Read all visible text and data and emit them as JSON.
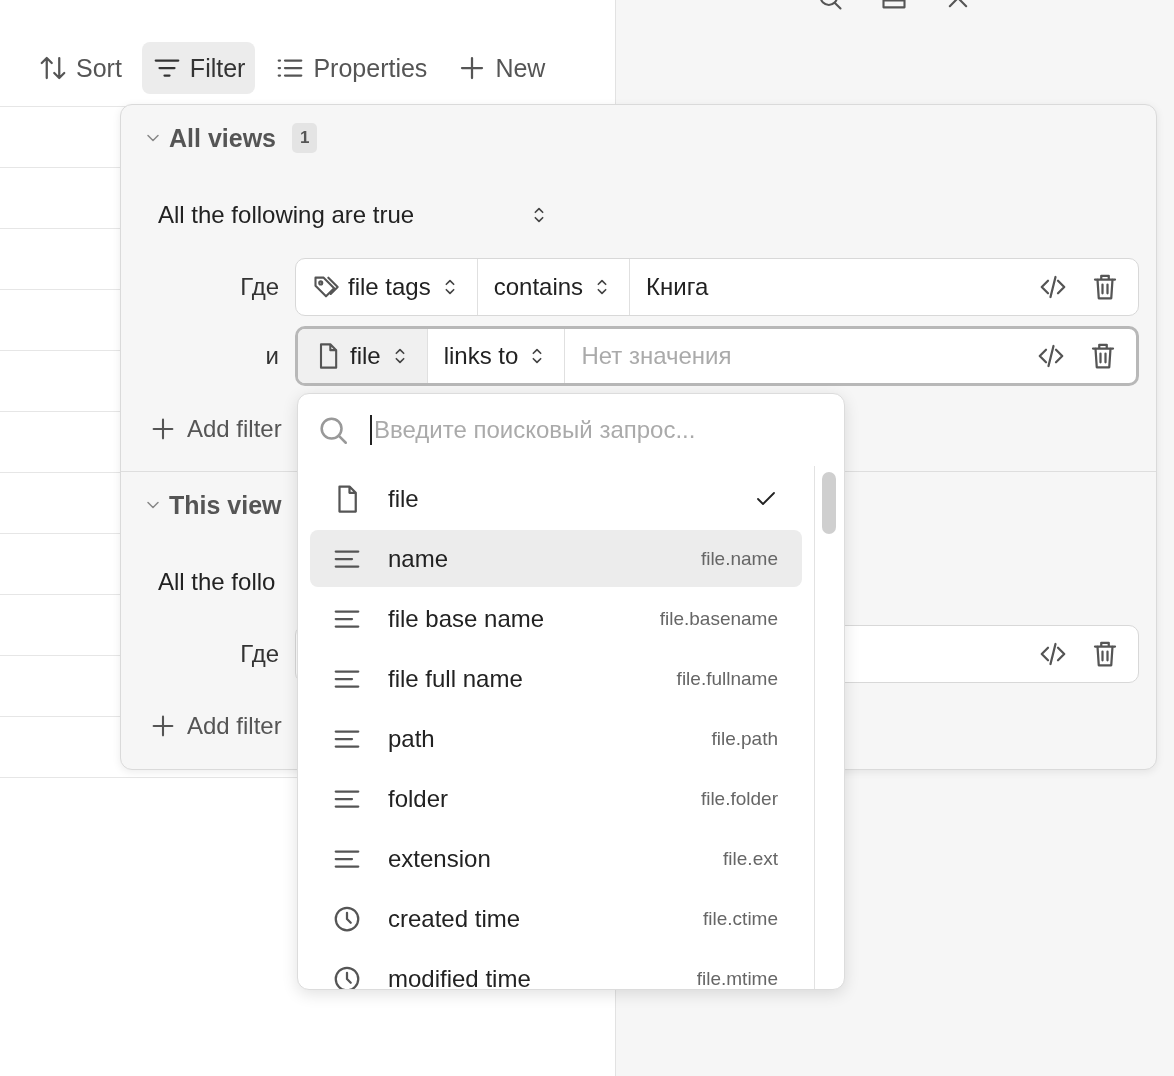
{
  "toolbar": [
    {
      "label": "Sort",
      "kind": "sort",
      "selected": false
    },
    {
      "label": "Filter",
      "kind": "filter",
      "selected": true
    },
    {
      "label": "Properties",
      "kind": "list",
      "selected": false
    },
    {
      "label": "New",
      "kind": "plus",
      "selected": false
    }
  ],
  "filter_panel": {
    "sections": [
      {
        "title": "All views",
        "count": "1",
        "expanded": true,
        "conjunction": "All the following are true",
        "filters": [
          {
            "prefix": "Где",
            "property": {
              "label": "file tags",
              "kind": "tag"
            },
            "operator": "contains",
            "value": "Книга",
            "active": false
          },
          {
            "prefix": "и",
            "property": {
              "label": "file",
              "kind": "file"
            },
            "operator": "links to",
            "placeholder": "Нет значения",
            "active": true
          }
        ],
        "add_label": "Add filter"
      },
      {
        "title": "This view",
        "expanded": true,
        "conjunction": "All the follo",
        "filters": [
          {
            "prefix": "Где",
            "active": false
          }
        ],
        "add_label": "Add filter"
      }
    ]
  },
  "property_dropdown": {
    "search": {
      "placeholder": "Введите поисковый запрос..."
    },
    "items": [
      {
        "label": "file",
        "kind": "file",
        "checked": true,
        "selected": false
      },
      {
        "label": "name",
        "key": "file.name",
        "kind": "text",
        "checked": false,
        "selected": true
      },
      {
        "label": "file base name",
        "key": "file.basename",
        "kind": "text",
        "checked": false,
        "selected": false
      },
      {
        "label": "file full name",
        "key": "file.fullname",
        "kind": "text",
        "checked": false,
        "selected": false
      },
      {
        "label": "path",
        "key": "file.path",
        "kind": "text",
        "checked": false,
        "selected": false
      },
      {
        "label": "folder",
        "key": "file.folder",
        "kind": "text",
        "checked": false,
        "selected": false
      },
      {
        "label": "extension",
        "key": "file.ext",
        "kind": "text",
        "checked": false,
        "selected": false
      },
      {
        "label": "created time",
        "key": "file.ctime",
        "kind": "time",
        "checked": false,
        "selected": false
      },
      {
        "label": "modified time",
        "key": "file.mtime",
        "kind": "time",
        "checked": false,
        "selected": false
      }
    ]
  }
}
